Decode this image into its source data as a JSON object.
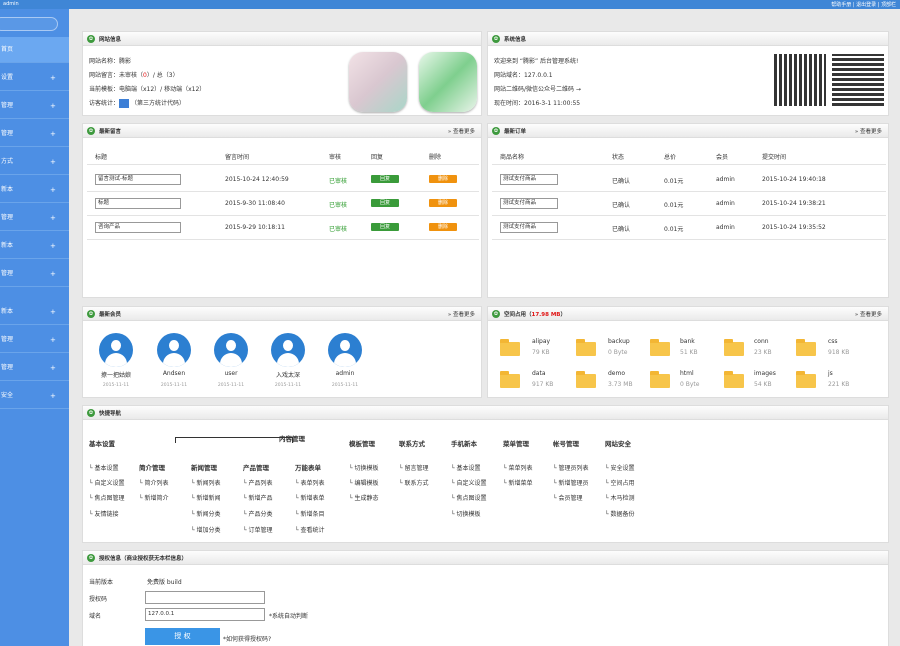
{
  "topbar": {
    "user": "admin",
    "links": "帮助手册 | 退出登录 | 顶部栏"
  },
  "sidebar": {
    "items": [
      {
        "label": "首页",
        "plus": ""
      },
      {
        "label": "设置",
        "plus": "+"
      },
      {
        "label": "管理",
        "plus": "+"
      },
      {
        "label": "管理",
        "plus": "+"
      },
      {
        "label": "方式",
        "plus": "+"
      },
      {
        "label": "新本",
        "plus": "+"
      },
      {
        "label": "管理",
        "plus": "+"
      },
      {
        "label": "新本",
        "plus": "+"
      },
      {
        "label": "管理",
        "plus": "+"
      },
      {
        "label": "新本",
        "plus": "+"
      },
      {
        "label": "管理",
        "plus": "+"
      },
      {
        "label": "管理",
        "plus": "+"
      },
      {
        "label": "安全",
        "plus": "+"
      }
    ]
  },
  "site_info": {
    "title": "网站信息",
    "line1": "网站名称：腾影",
    "line2_a": "网站留言：未审核（",
    "line2_b": "0",
    "line2_c": "）/ 总（3）",
    "line3": "当前模板：电脑端（x12）/ 移动端（x12）",
    "line4_a": "访客统计：",
    "line4_b": "（第三方统计代码）"
  },
  "system_info": {
    "title": "系统信息",
    "line1": "欢迎来到 “腾影” 后台管理系统!",
    "line2": "网站域名：127.0.0.1",
    "line3": "网站二维码/微信公众号二维码 →",
    "line4": "现在时间：2016-3-1 11:00:55"
  },
  "messages": {
    "title": "最新留言",
    "more": "» 查看更多",
    "headers": [
      "标题",
      "留言时间",
      "审核",
      "回复",
      "删除"
    ],
    "rows": [
      {
        "title": "留言测试-标题",
        "time": "2015-10-24 12:40:59",
        "status": "已审核",
        "reply": "回复",
        "del": "删除"
      },
      {
        "title": "标题",
        "time": "2015-9-30 11:08:40",
        "status": "已审核",
        "reply": "回复",
        "del": "删除"
      },
      {
        "title": "咨询产品",
        "time": "2015-9-29 10:18:11",
        "status": "已审核",
        "reply": "回复",
        "del": "删除"
      }
    ]
  },
  "orders": {
    "title": "最新订单",
    "more": "» 查看更多",
    "headers": [
      "商品名称",
      "状态",
      "总价",
      "会员",
      "提交时间"
    ],
    "rows": [
      {
        "name": "测试支付商品",
        "status": "已确认",
        "price": "0.01元",
        "member": "admin",
        "time": "2015-10-24 19:40:18"
      },
      {
        "name": "测试支付商品",
        "status": "已确认",
        "price": "0.01元",
        "member": "admin",
        "time": "2015-10-24 19:38:21"
      },
      {
        "name": "测试支付商品",
        "status": "已确认",
        "price": "0.01元",
        "member": "admin",
        "time": "2015-10-24 19:35:52"
      }
    ]
  },
  "members": {
    "title": "最新会员",
    "more": "» 查看更多",
    "list": [
      {
        "name": "撩一把姑娘",
        "date": "2015-11-11"
      },
      {
        "name": "Andsen",
        "date": "2015-11-11"
      },
      {
        "name": "user",
        "date": "2015-11-11"
      },
      {
        "name": "入戏太深",
        "date": "2015-11-11"
      },
      {
        "name": "admin",
        "date": "2015-11-11"
      }
    ]
  },
  "space": {
    "title_a": "空间占用（",
    "title_b": "17.98 MB",
    "title_c": "）",
    "more": "» 查看更多",
    "folders": [
      {
        "name": "alipay",
        "size": "79 KB"
      },
      {
        "name": "backup",
        "size": "0 Byte"
      },
      {
        "name": "bank",
        "size": "51 KB"
      },
      {
        "name": "conn",
        "size": "23 KB"
      },
      {
        "name": "css",
        "size": "918 KB"
      },
      {
        "name": "data",
        "size": "917 KB"
      },
      {
        "name": "demo",
        "size": "3.73 MB"
      },
      {
        "name": "html",
        "size": "0 Byte"
      },
      {
        "name": "images",
        "size": "54 KB"
      },
      {
        "name": "js",
        "size": "221 KB"
      }
    ]
  },
  "quicknav": {
    "title": "快捷导航",
    "group_basic": "基本设置",
    "group_content": "内容管理",
    "sub_headers": [
      "简介管理",
      "新闻管理",
      "产品管理",
      "万能表单"
    ],
    "group_template": "模板管理",
    "group_contact": "联系方式",
    "group_mobile": "手机新本",
    "group_menu": "菜单管理",
    "group_account": "帐号管理",
    "group_security": "网站安全",
    "basic": [
      "基本设置",
      "自定义设置",
      "焦点图管理",
      "友情链接"
    ],
    "intro": [
      "简介列表",
      "新增简介"
    ],
    "news": [
      "新闻列表",
      "新增新闻",
      "新闻分类",
      "增加分类"
    ],
    "product": [
      "产品列表",
      "新增产品",
      "产品分类",
      "订单管理"
    ],
    "form": [
      "表单列表",
      "新增表单",
      "新增条目",
      "查看统计"
    ],
    "template": [
      "切换模板",
      "编辑模板",
      "生成静态"
    ],
    "contact": [
      "留言管理",
      "联系方式"
    ],
    "mobile": [
      "基本设置",
      "自定义设置",
      "焦点图设置",
      "切换模板"
    ],
    "menu": [
      "菜单列表",
      "新增菜单"
    ],
    "account": [
      "管理员列表",
      "新增管理员",
      "会员管理"
    ],
    "security": [
      "安全设置",
      "空间占用",
      "木马检测",
      "数据备份"
    ]
  },
  "license": {
    "title": "授权信息（商业授权获无本栏信息）",
    "version_label": "当前版本",
    "version_value": "免费版 build",
    "code_label": "授权码",
    "domain_label": "域名",
    "domain_value": "127.0.0.1",
    "domain_note": "*系统自动判断",
    "submit": "授 权",
    "help": "*如何获得授权码?"
  }
}
